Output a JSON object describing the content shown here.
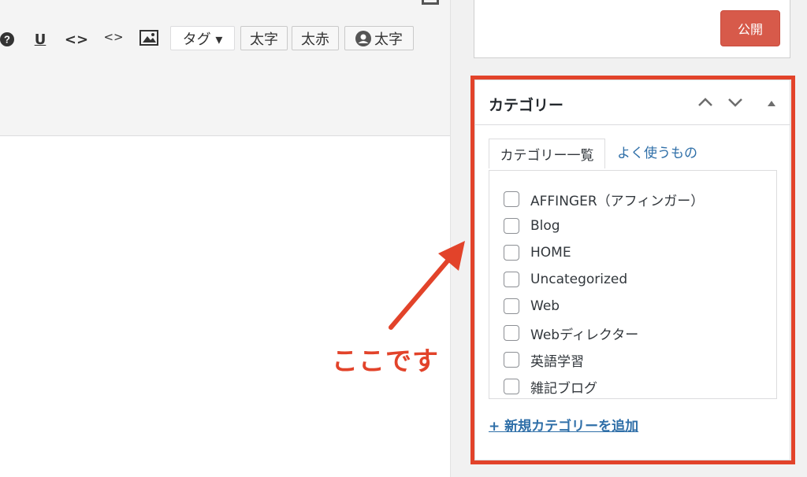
{
  "toolbar": {
    "help_icon": "question-icon",
    "underline_label": "U",
    "code_label": "<>",
    "inline_code_label": "<>",
    "image_icon": "image-icon",
    "tag_label": "タグ ▾",
    "bold_label": "太字",
    "bold_red_label": "太赤",
    "user_bold_label": "太字"
  },
  "publish": {
    "button_label": "公開"
  },
  "category": {
    "title": "カテゴリー",
    "tab_all": "カテゴリー一覧",
    "tab_popular": "よく使うもの",
    "items": [
      {
        "label": "AFFINGER（アフィンガー）"
      },
      {
        "label": "Blog"
      },
      {
        "label": "HOME"
      },
      {
        "label": "Uncategorized"
      },
      {
        "label": "Web"
      },
      {
        "label": "Webディレクター"
      },
      {
        "label": "英語学習"
      },
      {
        "label": "雑記ブログ"
      }
    ],
    "add_link": "+ 新規カテゴリーを追加"
  },
  "annotation": {
    "text": "ここです",
    "color": "#e2432a"
  },
  "colors": {
    "accent_red": "#e2432a",
    "publish_button": "#d75a4a",
    "link_blue": "#2f6fa8"
  }
}
